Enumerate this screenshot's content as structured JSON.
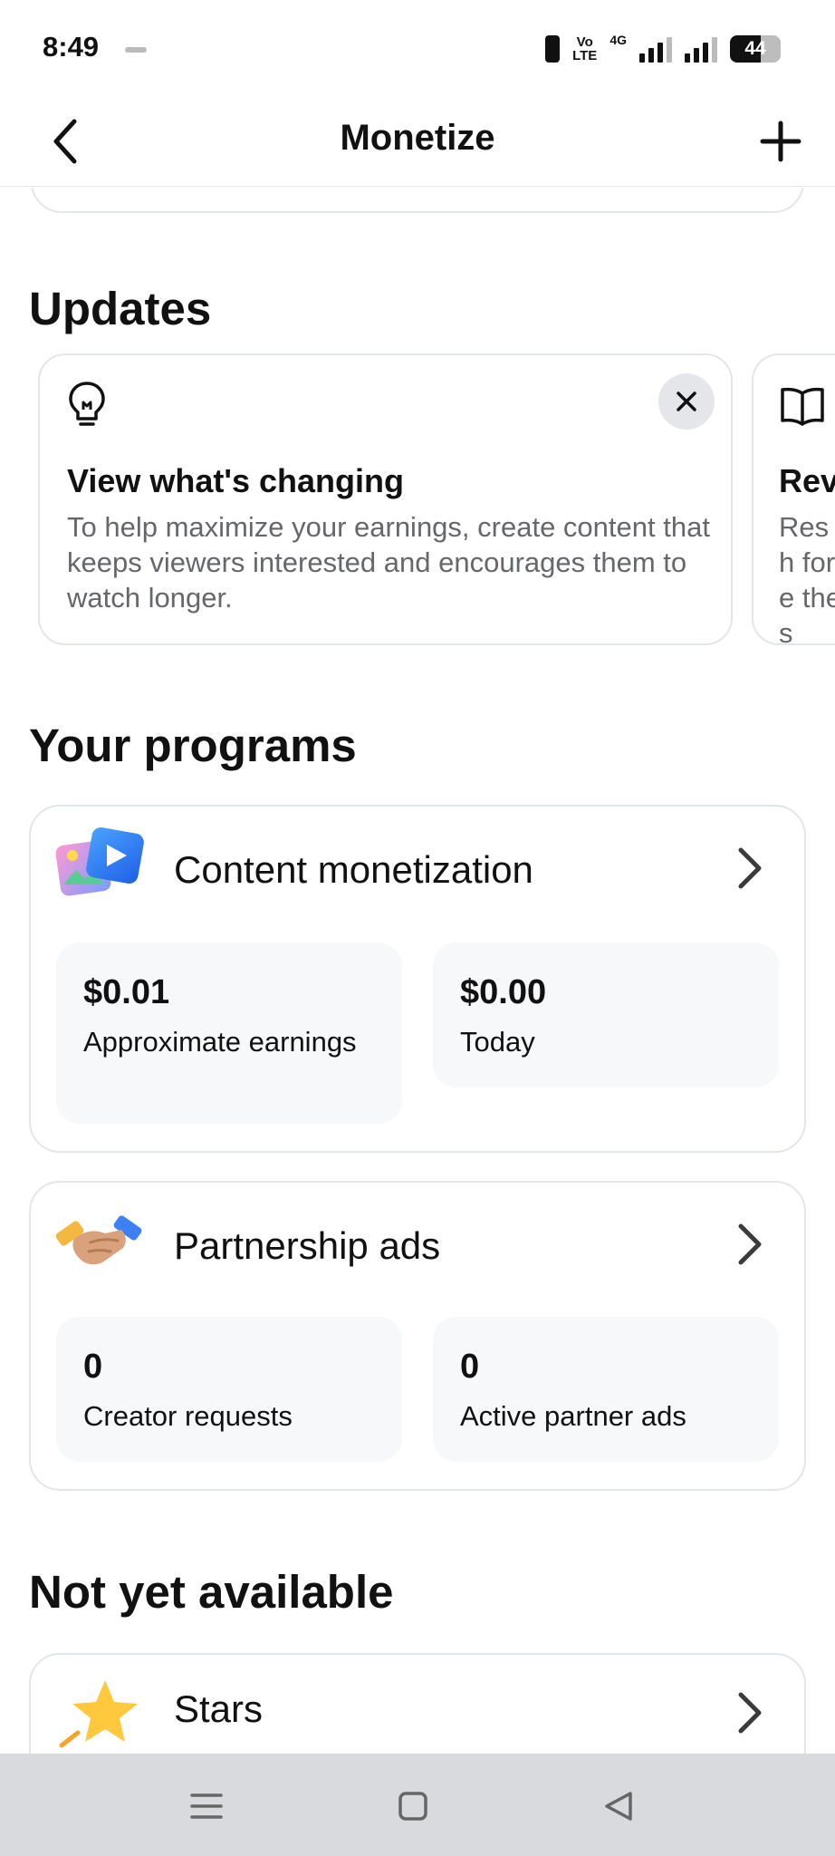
{
  "status_bar": {
    "time": "8:49",
    "volte_top": "Vo",
    "volte_bottom": "LTE",
    "network": "4G",
    "battery": "44"
  },
  "header": {
    "title": "Monetize",
    "back_icon": "chevron-left-icon",
    "add_icon": "plus-icon"
  },
  "updates": {
    "section_title": "Updates",
    "cards": [
      {
        "icon": "lightbulb-icon",
        "title": "View what's changing",
        "body": "To help maximize your earnings, create content that keeps viewers interested and encourages them to watch longer."
      },
      {
        "icon": "book-icon",
        "title": "Rev",
        "body": "Resh for e thes"
      }
    ]
  },
  "programs": {
    "section_title": "Your programs",
    "items": [
      {
        "title": "Content monetization",
        "icon": "photo-video-icon",
        "stats": [
          {
            "value": "$0.01",
            "label": "Approximate earnings"
          },
          {
            "value": "$0.00",
            "label": "Today"
          }
        ]
      },
      {
        "title": "Partnership ads",
        "icon": "handshake-icon",
        "stats": [
          {
            "value": "0",
            "label": "Creator requests"
          },
          {
            "value": "0",
            "label": "Active partner ads"
          }
        ]
      }
    ]
  },
  "not_available": {
    "section_title": "Not yet available",
    "items": [
      {
        "title": "Stars",
        "icon": "star-icon"
      }
    ]
  },
  "nav_bar": {
    "menu_icon": "menu-icon",
    "home_icon": "home-square-icon",
    "back_icon": "back-triangle-icon"
  },
  "colors": {
    "accent_blue": "#2f7bf6",
    "card_border": "#e3e6e8",
    "stat_bg": "#f6f8f9",
    "nav_bg": "#d8dadd"
  }
}
